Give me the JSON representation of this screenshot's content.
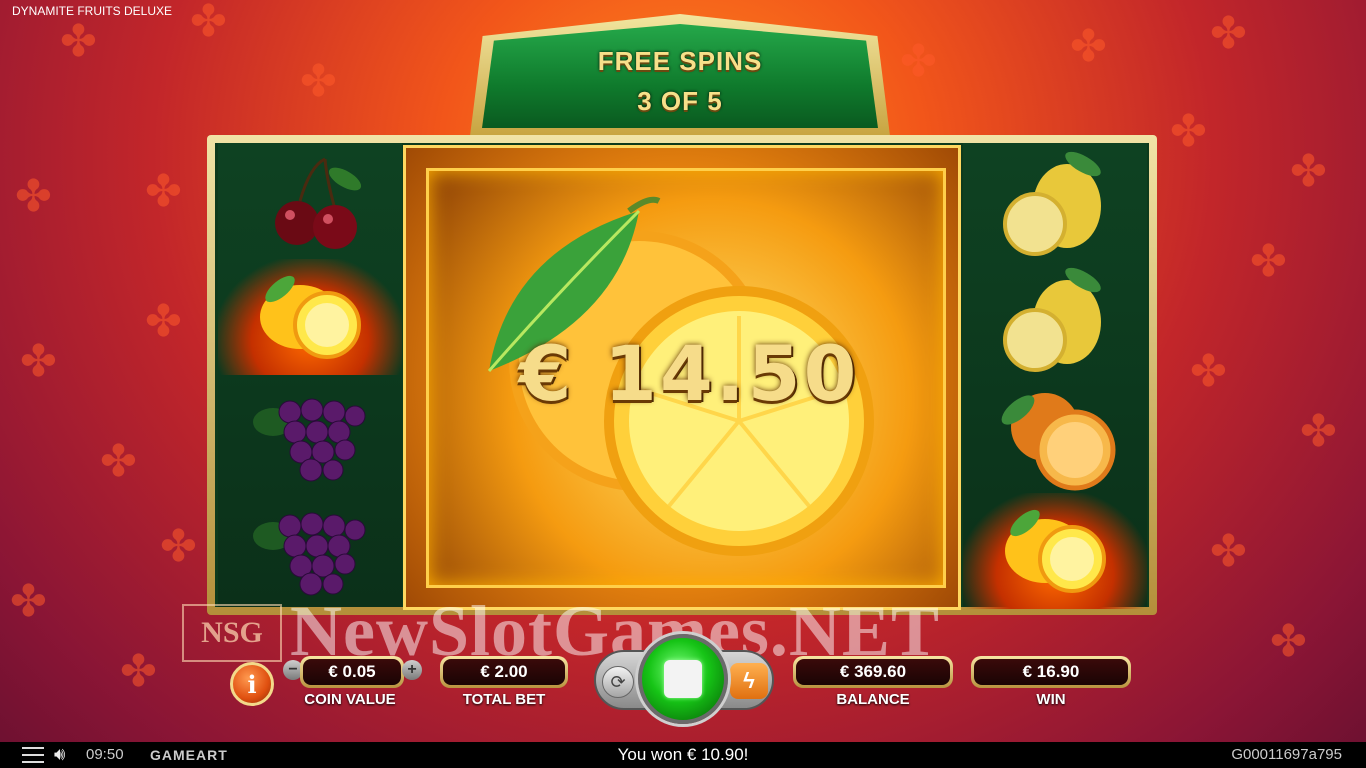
{
  "game_title": "DYNAMITE FRUITS DELUXE",
  "free_spins": {
    "line1": "FREE SPINS",
    "line2": "3 OF 5"
  },
  "reels": {
    "left": [
      "cherries",
      "lemon-burning",
      "grapes",
      "grapes"
    ],
    "center": "orange-big",
    "right": [
      "lemon",
      "lemon",
      "orange",
      "lemon-burning"
    ]
  },
  "win_symbol_amount": "€ 14.50",
  "watermark": {
    "logo": "NSG",
    "text": "NewSlotGames.NET"
  },
  "controls": {
    "info_icon": "i",
    "coin_value": "€ 0.05",
    "coin_value_label": "COIN VALUE",
    "minus": "−",
    "plus": "+",
    "total_bet": "€ 2.00",
    "total_bet_label": "TOTAL BET",
    "balance": "€ 369.60",
    "balance_label": "BALANCE",
    "win": "€ 16.90",
    "win_label": "WIN",
    "autoplay_icon": "⟳",
    "turbo_icon": "ϟ"
  },
  "bottom_bar": {
    "time": "09:50",
    "brand": "GAMEART",
    "status_message": "You won € 10.90!",
    "game_id": "G00011697a795"
  },
  "colors": {
    "accent_green": "#16c416",
    "gold": "#f7e08a",
    "background_red": "#c2262a"
  }
}
